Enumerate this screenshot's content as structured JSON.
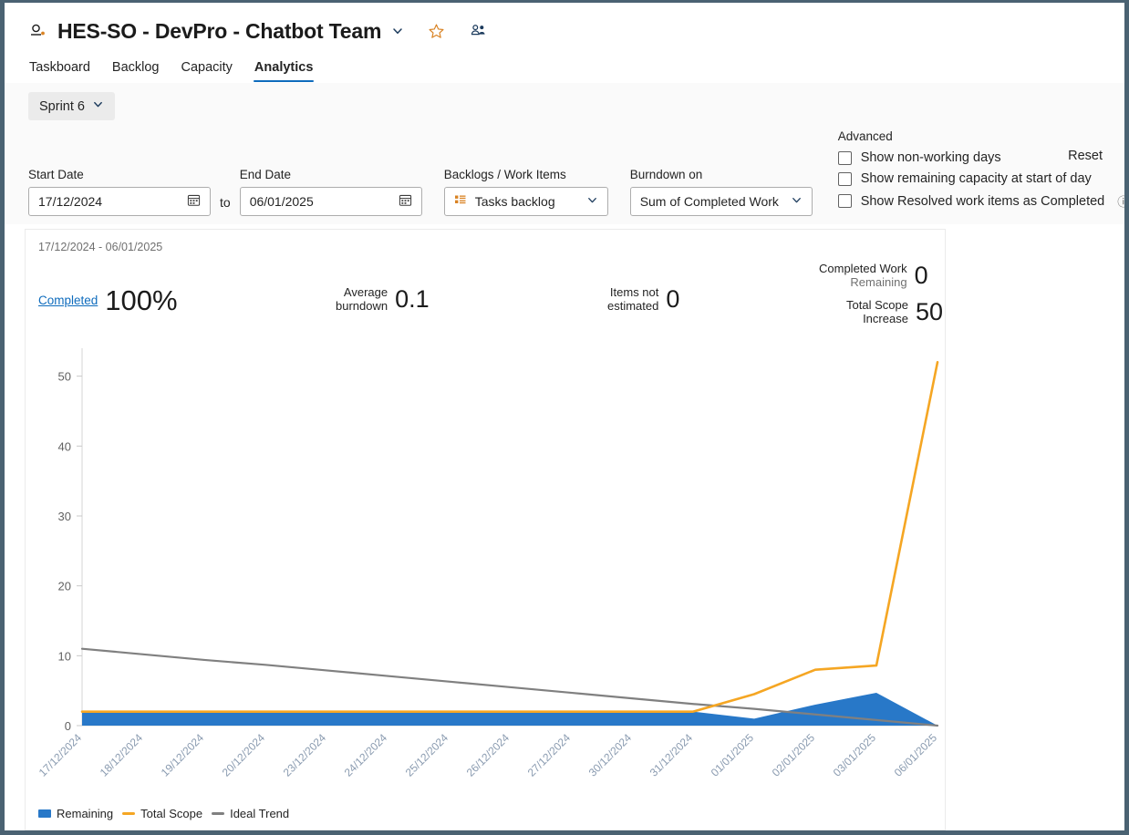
{
  "header": {
    "title": "HES-SO - DevPro - Chatbot Team",
    "team_icon": "team-icon",
    "chevron_icon": "chevron-down-icon",
    "star_icon": "star-icon",
    "members_icon": "team-members-icon",
    "tabs": [
      {
        "label": "Taskboard",
        "active": false
      },
      {
        "label": "Backlog",
        "active": false
      },
      {
        "label": "Capacity",
        "active": false
      },
      {
        "label": "Analytics",
        "active": true
      }
    ]
  },
  "filters": {
    "sprint": "Sprint 6",
    "start_date_label": "Start Date",
    "start_date_value": "17/12/2024",
    "to_word": "to",
    "end_date_label": "End Date",
    "end_date_value": "06/01/2025",
    "calendar_icon": "calendar-icon",
    "backlog_label": "Backlogs / Work Items",
    "backlog_value": "Tasks backlog",
    "backlog_icon": "backlog-grid-icon",
    "burndown_label": "Burndown on",
    "burndown_value": "Sum of Completed Work",
    "advanced_label": "Advanced",
    "checkboxes": [
      {
        "label": "Show non-working days",
        "checked": false
      },
      {
        "label": "Show remaining capacity at start of day",
        "checked": false
      },
      {
        "label": "Show Resolved work items as Completed",
        "checked": false,
        "info": "ⓘ"
      }
    ],
    "reset_label": "Reset"
  },
  "card": {
    "date_range": "17/12/2024 - 06/01/2025",
    "kpis": {
      "completed_link": "Completed",
      "completed_value": "100%",
      "avg_line1": "Average",
      "avg_line2": "burndown",
      "avg_value": "0.1",
      "notest_line1": "Items not",
      "notest_line2": "estimated",
      "notest_value": "0",
      "cwr_line1": "Completed Work",
      "cwr_line2": "Remaining",
      "cwr_value": "0",
      "scope_line1": "Total Scope",
      "scope_line2": "Increase",
      "scope_value": "50"
    }
  },
  "colors": {
    "remaining": "#2878c8",
    "total_scope": "#f5a623",
    "ideal_trend": "#808080",
    "accent": "#0f6cbd",
    "star": "#d98324"
  },
  "chart_data": {
    "type": "area",
    "title": "",
    "xlabel": "",
    "ylabel": "",
    "ylim": [
      0,
      54
    ],
    "yticks": [
      0,
      10,
      20,
      30,
      40,
      50
    ],
    "grid": false,
    "legend_position": "bottom-left",
    "categories": [
      "17/12/2024",
      "18/12/2024",
      "19/12/2024",
      "20/12/2024",
      "23/12/2024",
      "24/12/2024",
      "25/12/2024",
      "26/12/2024",
      "27/12/2024",
      "30/12/2024",
      "31/12/2024",
      "01/01/2025",
      "02/01/2025",
      "03/01/2025",
      "06/01/2025"
    ],
    "series": [
      {
        "name": "Remaining",
        "type": "area",
        "color": "#2878c8",
        "values": [
          2,
          2,
          2,
          2,
          2,
          2,
          2,
          2,
          2,
          2,
          2,
          1,
          3,
          4.7,
          0
        ]
      },
      {
        "name": "Total Scope",
        "type": "line",
        "color": "#f5a623",
        "values": [
          2,
          2,
          2,
          2,
          2,
          2,
          2,
          2,
          2,
          2,
          2,
          4.5,
          8,
          8.6,
          52
        ]
      },
      {
        "name": "Ideal Trend",
        "type": "line",
        "color": "#808080",
        "values": [
          11,
          10.2,
          9.4,
          8.7,
          7.9,
          7.1,
          6.3,
          5.5,
          4.7,
          3.9,
          3.1,
          2.4,
          1.6,
          0.8,
          0
        ]
      }
    ]
  }
}
